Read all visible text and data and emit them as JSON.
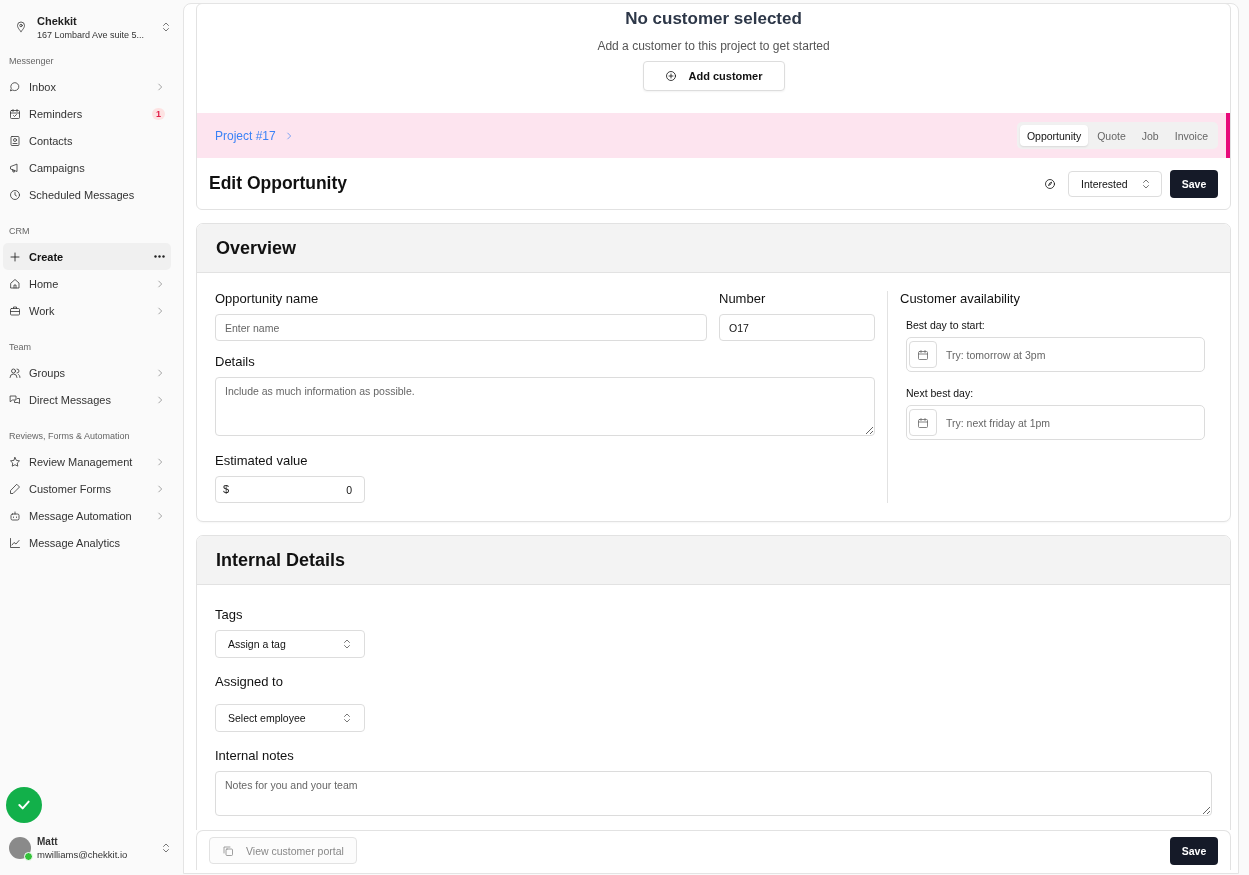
{
  "workspace": {
    "name": "Chekkit",
    "address": "167 Lombard Ave suite 5..."
  },
  "sidebar": {
    "sections": [
      {
        "title": "Messenger",
        "items": [
          {
            "label": "Inbox",
            "kind": "chevron",
            "selected": false
          },
          {
            "label": "Reminders",
            "kind": "badge",
            "badge": "1",
            "selected": false
          },
          {
            "label": "Contacts",
            "kind": "plain",
            "selected": false
          },
          {
            "label": "Campaigns",
            "kind": "plain",
            "selected": false
          },
          {
            "label": "Scheduled Messages",
            "kind": "plain",
            "selected": false
          }
        ]
      },
      {
        "title": "CRM",
        "items": [
          {
            "label": "Create",
            "kind": "menu",
            "selected": true
          },
          {
            "label": "Home",
            "kind": "chevron",
            "selected": false
          },
          {
            "label": "Work",
            "kind": "chevron",
            "selected": false
          }
        ]
      },
      {
        "title": "Team",
        "items": [
          {
            "label": "Groups",
            "kind": "chevron",
            "selected": false
          },
          {
            "label": "Direct Messages",
            "kind": "chevron",
            "selected": false
          }
        ]
      },
      {
        "title": "Reviews, Forms & Automation",
        "items": [
          {
            "label": "Review Management",
            "kind": "chevron",
            "selected": false
          },
          {
            "label": "Customer Forms",
            "kind": "chevron",
            "selected": false
          },
          {
            "label": "Message Automation",
            "kind": "chevron",
            "selected": false
          },
          {
            "label": "Message Analytics",
            "kind": "plain",
            "selected": false
          }
        ]
      }
    ]
  },
  "user": {
    "name": "Matt",
    "email": "mwilliams@chekkit.io",
    "online": true
  },
  "customer": {
    "title": "No customer selected",
    "subtitle": "Add a customer to this project to get started",
    "button": "Add customer"
  },
  "project": {
    "breadcrumb": "Project #17",
    "tabs": [
      {
        "label": "Opportunity",
        "selected": true
      },
      {
        "label": "Quote",
        "selected": false
      },
      {
        "label": "Job",
        "selected": false
      },
      {
        "label": "Invoice",
        "selected": false
      }
    ]
  },
  "header": {
    "title": "Edit Opportunity",
    "status": "Interested",
    "save": "Save"
  },
  "overview": {
    "title": "Overview",
    "opportunity_name": {
      "label": "Opportunity name",
      "placeholder": "Enter name"
    },
    "number": {
      "label": "Number",
      "value": "O17"
    },
    "details": {
      "label": "Details",
      "placeholder": "Include as much information as possible."
    },
    "estimated_value": {
      "label": "Estimated value",
      "prefix": "$",
      "value": "0"
    },
    "availability": {
      "title": "Customer availability",
      "fields": [
        {
          "label": "Best day to start:",
          "placeholder": "Try: tomorrow at 3pm"
        },
        {
          "label": "Next best day:",
          "placeholder": "Try: next friday at 1pm"
        }
      ]
    }
  },
  "internal": {
    "title": "Internal Details",
    "tags": {
      "label": "Tags",
      "value": "Assign a tag"
    },
    "assigned_to": {
      "label": "Assigned to",
      "value": "Select employee"
    },
    "notes": {
      "label": "Internal notes",
      "placeholder": "Notes for you and your team"
    }
  },
  "footer": {
    "portal_button": "View customer portal",
    "portal_disabled": true,
    "save": "Save"
  }
}
